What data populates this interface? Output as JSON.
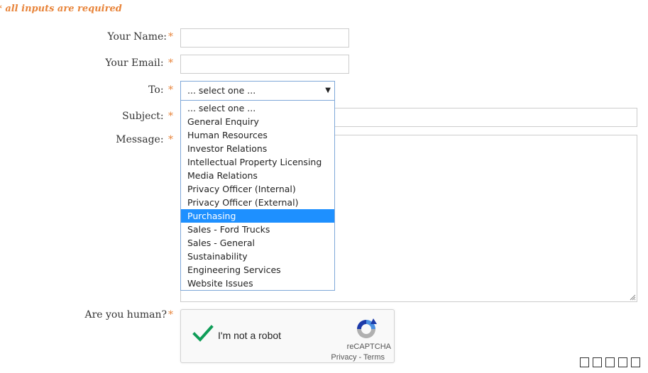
{
  "form": {
    "required_note": "* all inputs are required",
    "required_marker": "*",
    "name_label": "Your Name:",
    "email_label": "Your Email:",
    "to_label": "To:",
    "subject_label": "Subject:",
    "message_label": "Message:",
    "human_label": "Are you human?",
    "name_value": "",
    "email_value": "",
    "subject_value": "",
    "message_value": ""
  },
  "to_select": {
    "selected_text": "... select one ...",
    "highlighted_index": 8,
    "options": [
      "... select one ...",
      "General Enquiry",
      "Human Resources",
      "Investor Relations",
      "Intellectual Property Licensing",
      "Media Relations",
      "Privacy Officer (Internal)",
      "Privacy Officer (External)",
      "Purchasing",
      "Sales - Ford Trucks",
      "Sales - General",
      "Sustainability",
      "Engineering Services",
      "Website Issues"
    ]
  },
  "captcha": {
    "label": "I'm not a robot",
    "brand": "reCAPTCHA",
    "privacy": "Privacy",
    "separator": " - ",
    "terms": "Terms",
    "checked": true,
    "check_color": "#0f9d58"
  },
  "colors": {
    "accent": "#e8843a",
    "highlight": "#1e90ff",
    "select_border": "#7ea7d8"
  }
}
